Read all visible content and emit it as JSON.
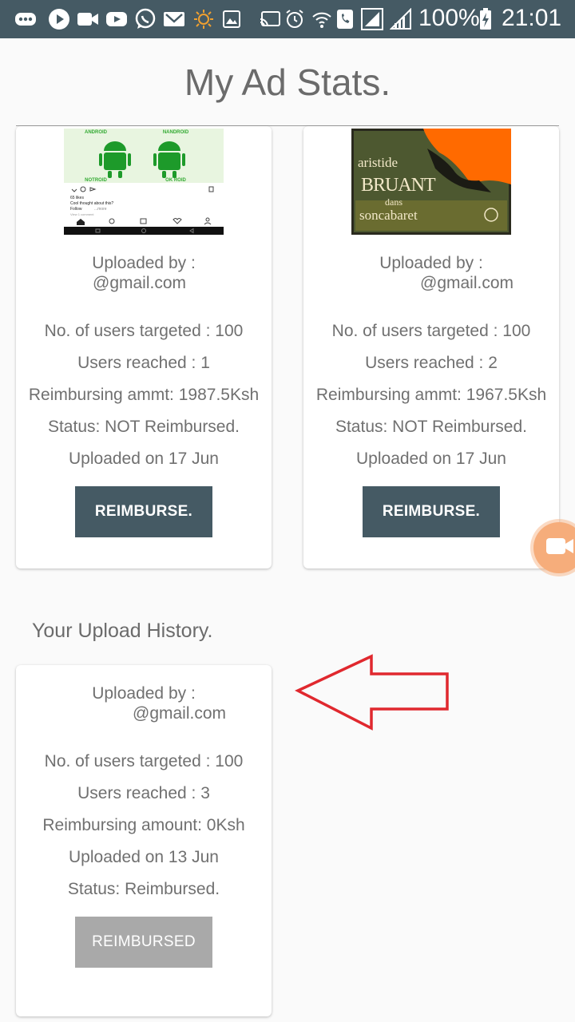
{
  "status_bar": {
    "battery": "100%",
    "time": "21:01",
    "icons": [
      "more-icon",
      "play-icon",
      "video-icon",
      "youtube-icon",
      "whatsapp-icon",
      "gmail-icon",
      "brightness-icon",
      "image-icon",
      "cast-icon",
      "alarm-icon",
      "wifi-icon",
      "phone-icon",
      "signal-icon",
      "signal-icon",
      "battery-icon"
    ]
  },
  "page": {
    "title": "My Ad Stats."
  },
  "ad_cards": [
    {
      "image": "android-meme-thumbnail",
      "uploaded_by_label": "Uploaded by :",
      "uploaded_by_email": "@gmail.com",
      "targeted": "No. of users targeted : 100",
      "reached": "Users reached : 1",
      "amount": "Reimbursing ammt: 1987.5Ksh",
      "status": "Status: NOT Reimbursed.",
      "uploaded_on": "Uploaded on 17 Jun",
      "button": "REIMBURSE."
    },
    {
      "image": "aristide-bruant-poster",
      "uploaded_by_label": "Uploaded by :",
      "uploaded_by_email": "@gmail.com",
      "targeted": "No. of users targeted : 100",
      "reached": "Users reached : 2",
      "amount": "Reimbursing ammt: 1967.5Ksh",
      "status": "Status: NOT Reimbursed.",
      "uploaded_on": "Uploaded on 17 Jun",
      "button": "REIMBURSE."
    }
  ],
  "history": {
    "title": "Your Upload History.",
    "card": {
      "uploaded_by_label": "Uploaded by :",
      "uploaded_by_email": "@gmail.com",
      "targeted": "No. of users targeted : 100",
      "reached": "Users reached : 3",
      "amount": "Reimbursing amount:  0Ksh",
      "uploaded_on": "Uploaded on 13 Jun",
      "status": "Status: Reimbursed.",
      "button": "REIMBURSED"
    }
  },
  "thumbnail_text": {
    "meme_top_left": "ANDROID",
    "meme_top_right": "NANDROID",
    "meme_bottom_left": "NOTROID",
    "meme_bottom_right": "OK ROID",
    "meme_likes": "65 likes",
    "meme_caption": "Cool thought about this?",
    "meme_follow": "Follow",
    "meme_more": "...more",
    "meme_comments": "View 1 comment",
    "poster_line1": "aristide",
    "poster_line2": "BRUANT",
    "poster_line3": "dans",
    "poster_line4": "soncabaret"
  },
  "colors": {
    "status_bar": "#455a64",
    "button": "#455a64",
    "button_disabled": "#a9a9a9",
    "annotation_arrow": "#e0282e",
    "fab": "#f6ad7b"
  }
}
